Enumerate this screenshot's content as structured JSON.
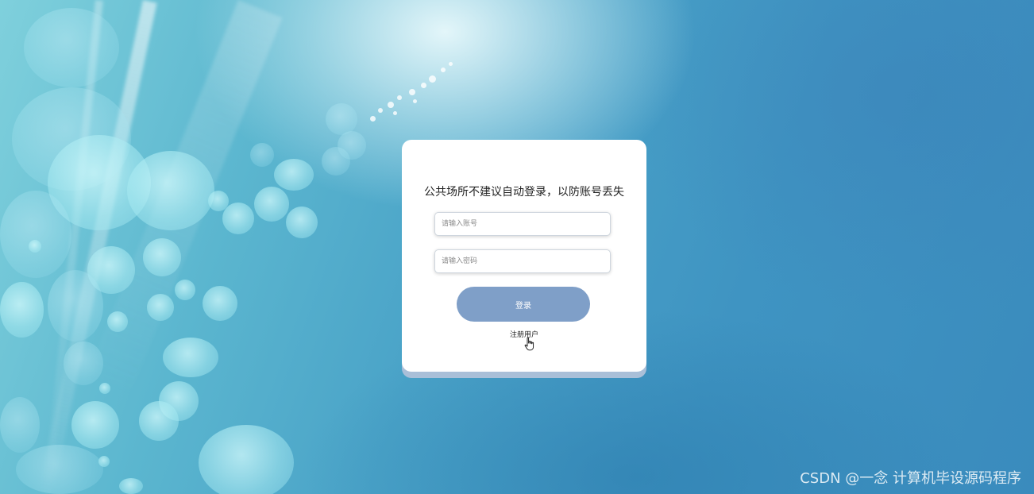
{
  "login": {
    "notice": "公共场所不建议自动登录，以防账号丢失",
    "username_placeholder": "请输入账号",
    "password_placeholder": "请输入密码",
    "login_label": "登录",
    "register_label": "注册用户"
  },
  "watermark": "CSDN @一念 计算机毕设源码程序",
  "colors": {
    "button": "#7f9fc8",
    "card": "#ffffff",
    "card_shadow": "#a9bfd8"
  },
  "icons": {
    "cursor": "hand-pointer-icon"
  }
}
